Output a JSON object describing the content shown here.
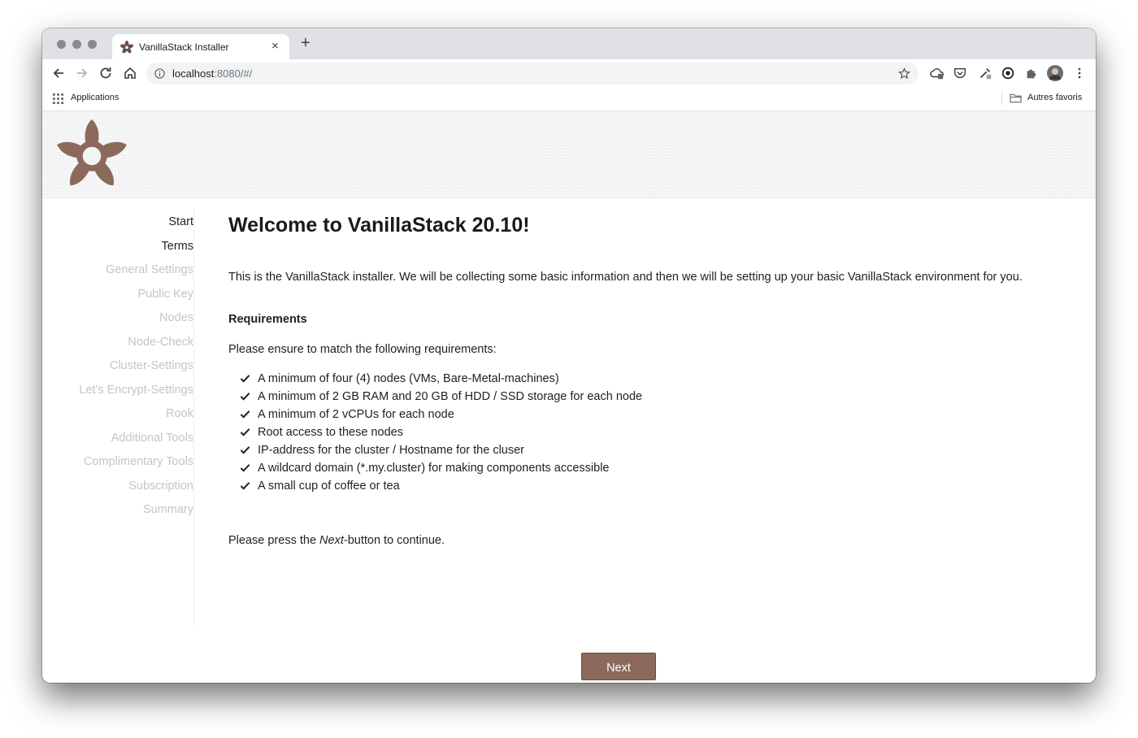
{
  "browser": {
    "tab_title": "VanillaStack Installer",
    "new_tab_symbol": "+",
    "close_symbol": "×",
    "url_host": "localhost",
    "url_rest": ":8080/#/",
    "bookmark_apps": "Applications",
    "bookmark_folder": "Autres favoris"
  },
  "sidebar": {
    "items": [
      {
        "label": "Start",
        "state": "active"
      },
      {
        "label": "Terms",
        "state": "active"
      },
      {
        "label": "General Settings",
        "state": "inactive"
      },
      {
        "label": "Public Key",
        "state": "inactive"
      },
      {
        "label": "Nodes",
        "state": "inactive"
      },
      {
        "label": "Node-Check",
        "state": "inactive"
      },
      {
        "label": "Cluster-Settings",
        "state": "inactive"
      },
      {
        "label": "Let's Encrypt-Settings",
        "state": "inactive"
      },
      {
        "label": "Rook",
        "state": "inactive"
      },
      {
        "label": "Additional Tools",
        "state": "inactive"
      },
      {
        "label": "Complimentary Tools",
        "state": "inactive"
      },
      {
        "label": "Subscription",
        "state": "inactive"
      },
      {
        "label": "Summary",
        "state": "inactive"
      }
    ]
  },
  "main": {
    "title": "Welcome to VanillaStack 20.10!",
    "intro": "This is the VanillaStack installer. We will be collecting some basic information and then we will be setting up your basic VanillaStack environment for you.",
    "requirements_title": "Requirements",
    "requirements_intro": "Please ensure to match the following requirements:",
    "requirements": [
      "A minimum of four (4) nodes (VMs, Bare-Metal-machines)",
      "A minimum of 2 GB RAM and 20 GB of HDD / SSD storage for each node",
      "A minimum of 2 vCPUs for each node",
      "Root access to these nodes",
      "IP-address for the cluster / Hostname for the cluser",
      "A wildcard domain (*.my.cluster) for making components accessible",
      "A small cup of coffee or tea"
    ],
    "continue_before": "Please press the ",
    "continue_em": "Next",
    "continue_after": "-button to continue."
  },
  "footer": {
    "next_label": "Next"
  },
  "colors": {
    "brand": "#8b6a5c",
    "active_text": "#222222",
    "inactive_text": "#c5c5c5"
  }
}
